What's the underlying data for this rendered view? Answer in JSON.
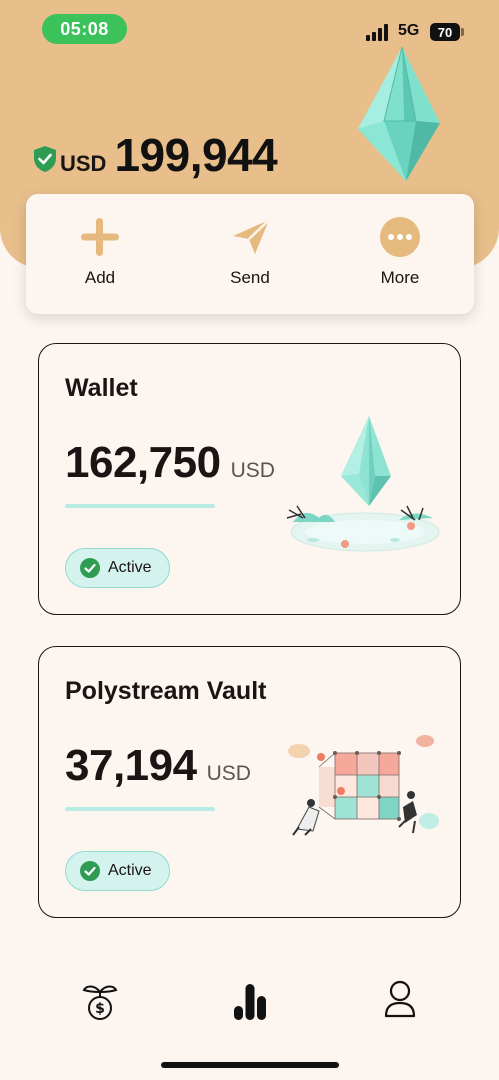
{
  "status_bar": {
    "time": "05:08",
    "network": "5G",
    "battery": "70"
  },
  "header": {
    "currency": "USD",
    "total_balance": "199,944",
    "accent_color": "#e8bf8b"
  },
  "actions": [
    {
      "label": "Add",
      "icon": "plus-icon"
    },
    {
      "label": "Send",
      "icon": "send-icon"
    },
    {
      "label": "More",
      "icon": "more-icon"
    }
  ],
  "accounts": [
    {
      "title": "Wallet",
      "amount": "162,750",
      "currency": "USD",
      "status": "Active",
      "illustration": "crystal-pond-illustration"
    },
    {
      "title": "Polystream Vault",
      "amount": "37,194",
      "currency": "USD",
      "status": "Active",
      "illustration": "cube-vault-illustration"
    }
  ],
  "bottom_nav": [
    {
      "icon": "money-plant-icon",
      "active": false
    },
    {
      "icon": "bar-chart-icon",
      "active": true
    },
    {
      "icon": "profile-icon",
      "active": false
    }
  ]
}
